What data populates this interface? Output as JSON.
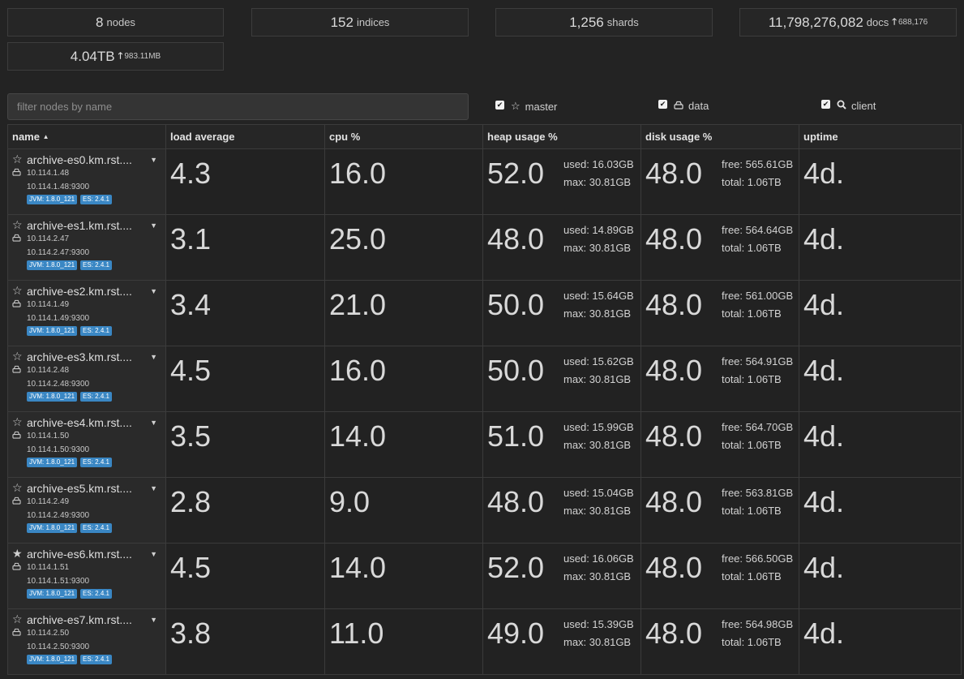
{
  "stats": {
    "nodes": {
      "value": "8",
      "label": "nodes"
    },
    "indices": {
      "value": "152",
      "label": "indices"
    },
    "shards": {
      "value": "1,256",
      "label": "shards"
    },
    "docs": {
      "value": "11,798,276,082",
      "label": "docs",
      "delta": "688,176"
    },
    "size": {
      "value": "4.04TB",
      "delta": "983.11MB"
    }
  },
  "filter": {
    "placeholder": "filter nodes by name",
    "value": ""
  },
  "options": {
    "master": "master",
    "data": "data",
    "client": "client"
  },
  "columns": {
    "name": "name",
    "load": "load average",
    "cpu": "cpu %",
    "heap": "heap usage %",
    "disk": "disk usage %",
    "uptime": "uptime"
  },
  "icons": {
    "sort": "sort-asc-icon",
    "star": "star-icon",
    "drive": "hdd-icon",
    "search": "search-icon",
    "caret": "caret-down-icon"
  },
  "accent": "#3a87c4",
  "nodes": [
    {
      "name": "archive-es0.km.rst....",
      "ip": "10.114.1.48",
      "addr": "10.114.1.48:9300",
      "jvm": "JVM: 1.8.0_121",
      "es": "ES: 2.4.1",
      "master": false,
      "load": "4.3",
      "cpu": "16.0",
      "heap": "52.0",
      "heap_used": "used: 16.03GB",
      "heap_max": "max: 30.81GB",
      "disk": "48.0",
      "disk_free": "free: 565.61GB",
      "disk_total": "total: 1.06TB",
      "uptime": "4d."
    },
    {
      "name": "archive-es1.km.rst....",
      "ip": "10.114.2.47",
      "addr": "10.114.2.47:9300",
      "jvm": "JVM: 1.8.0_121",
      "es": "ES: 2.4.1",
      "master": false,
      "load": "3.1",
      "cpu": "25.0",
      "heap": "48.0",
      "heap_used": "used: 14.89GB",
      "heap_max": "max: 30.81GB",
      "disk": "48.0",
      "disk_free": "free: 564.64GB",
      "disk_total": "total: 1.06TB",
      "uptime": "4d."
    },
    {
      "name": "archive-es2.km.rst....",
      "ip": "10.114.1.49",
      "addr": "10.114.1.49:9300",
      "jvm": "JVM: 1.8.0_121",
      "es": "ES: 2.4.1",
      "master": false,
      "load": "3.4",
      "cpu": "21.0",
      "heap": "50.0",
      "heap_used": "used: 15.64GB",
      "heap_max": "max: 30.81GB",
      "disk": "48.0",
      "disk_free": "free: 561.00GB",
      "disk_total": "total: 1.06TB",
      "uptime": "4d."
    },
    {
      "name": "archive-es3.km.rst....",
      "ip": "10.114.2.48",
      "addr": "10.114.2.48:9300",
      "jvm": "JVM: 1.8.0_121",
      "es": "ES: 2.4.1",
      "master": false,
      "load": "4.5",
      "cpu": "16.0",
      "heap": "50.0",
      "heap_used": "used: 15.62GB",
      "heap_max": "max: 30.81GB",
      "disk": "48.0",
      "disk_free": "free: 564.91GB",
      "disk_total": "total: 1.06TB",
      "uptime": "4d."
    },
    {
      "name": "archive-es4.km.rst....",
      "ip": "10.114.1.50",
      "addr": "10.114.1.50:9300",
      "jvm": "JVM: 1.8.0_121",
      "es": "ES: 2.4.1",
      "master": false,
      "load": "3.5",
      "cpu": "14.0",
      "heap": "51.0",
      "heap_used": "used: 15.99GB",
      "heap_max": "max: 30.81GB",
      "disk": "48.0",
      "disk_free": "free: 564.70GB",
      "disk_total": "total: 1.06TB",
      "uptime": "4d."
    },
    {
      "name": "archive-es5.km.rst....",
      "ip": "10.114.2.49",
      "addr": "10.114.2.49:9300",
      "jvm": "JVM: 1.8.0_121",
      "es": "ES: 2.4.1",
      "master": false,
      "load": "2.8",
      "cpu": "9.0",
      "heap": "48.0",
      "heap_used": "used: 15.04GB",
      "heap_max": "max: 30.81GB",
      "disk": "48.0",
      "disk_free": "free: 563.81GB",
      "disk_total": "total: 1.06TB",
      "uptime": "4d."
    },
    {
      "name": "archive-es6.km.rst....",
      "ip": "10.114.1.51",
      "addr": "10.114.1.51:9300",
      "jvm": "JVM: 1.8.0_121",
      "es": "ES: 2.4.1",
      "master": true,
      "load": "4.5",
      "cpu": "14.0",
      "heap": "52.0",
      "heap_used": "used: 16.06GB",
      "heap_max": "max: 30.81GB",
      "disk": "48.0",
      "disk_free": "free: 566.50GB",
      "disk_total": "total: 1.06TB",
      "uptime": "4d."
    },
    {
      "name": "archive-es7.km.rst....",
      "ip": "10.114.2.50",
      "addr": "10.114.2.50:9300",
      "jvm": "JVM: 1.8.0_121",
      "es": "ES: 2.4.1",
      "master": false,
      "load": "3.8",
      "cpu": "11.0",
      "heap": "49.0",
      "heap_used": "used: 15.39GB",
      "heap_max": "max: 30.81GB",
      "disk": "48.0",
      "disk_free": "free: 564.98GB",
      "disk_total": "total: 1.06TB",
      "uptime": "4d."
    }
  ]
}
